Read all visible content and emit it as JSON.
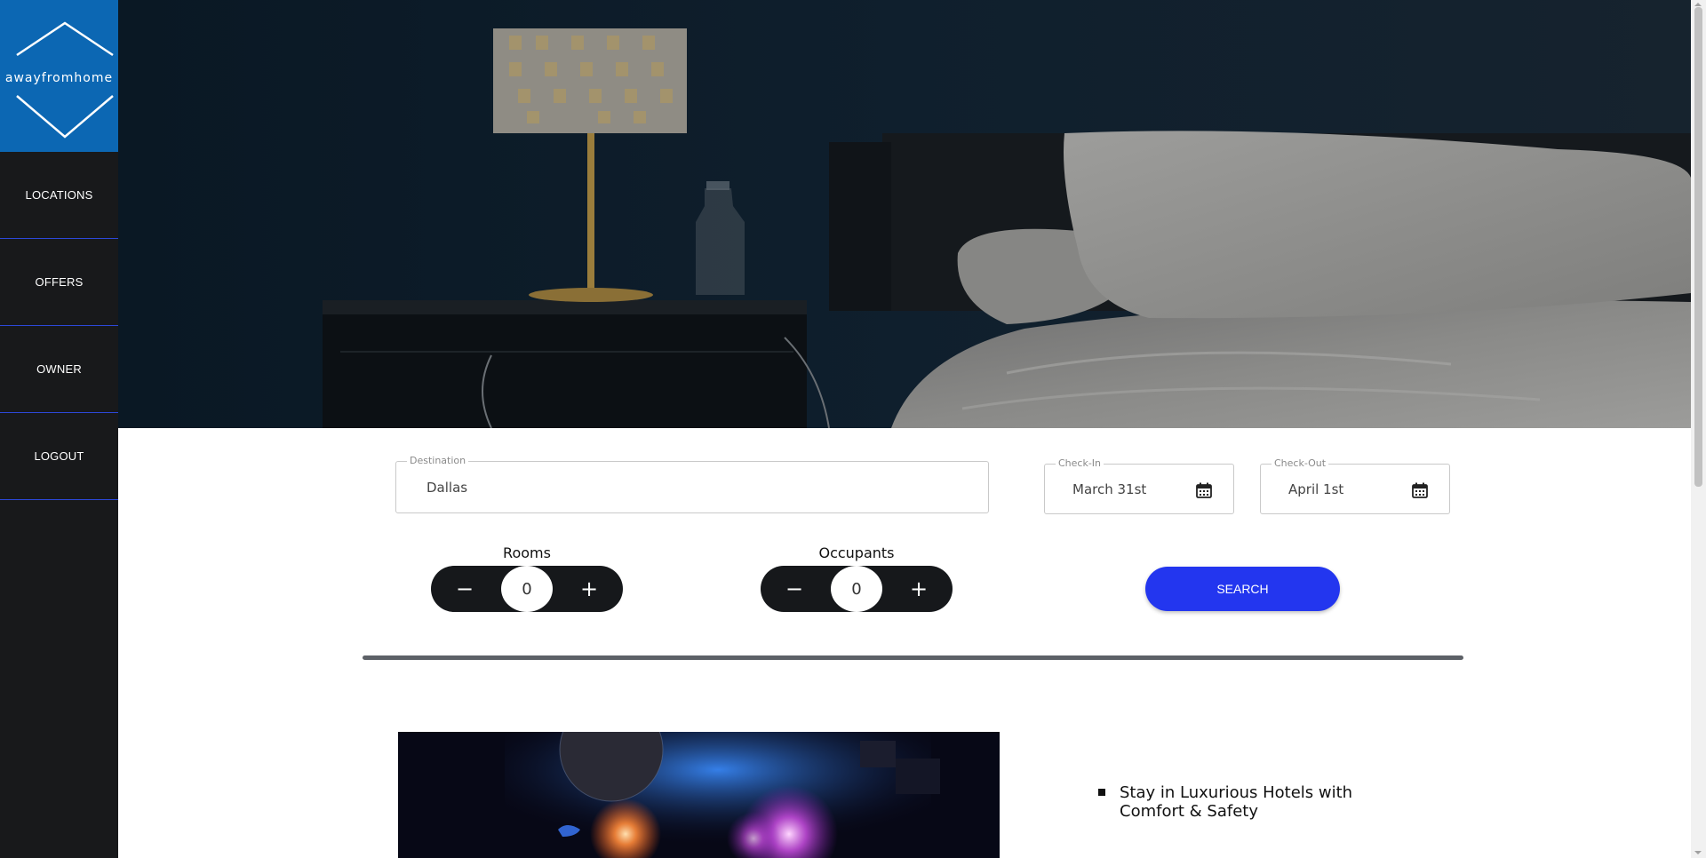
{
  "brand": {
    "name": "awayfromhome",
    "color": "#0c67b3"
  },
  "nav": {
    "items": [
      {
        "label": "LOCATIONS"
      },
      {
        "label": "OFFERS"
      },
      {
        "label": "OWNER"
      },
      {
        "label": "LOGOUT"
      }
    ]
  },
  "search": {
    "destination": {
      "legend": "Destination",
      "value": "Dallas"
    },
    "checkin": {
      "legend": "Check-In",
      "value": "March 31st",
      "icon": "calendar-icon"
    },
    "checkout": {
      "legend": "Check-Out",
      "value": "April 1st",
      "icon": "calendar-icon"
    },
    "rooms": {
      "label": "Rooms",
      "value": "0",
      "decrement": "−",
      "increment": "+"
    },
    "occupants": {
      "label": "Occupants",
      "value": "0",
      "decrement": "−",
      "increment": "+"
    },
    "button_label": "SEARCH",
    "accent_color": "#2336ef"
  },
  "features": [
    {
      "text": "Stay in Luxurious Hotels with Comfort & Safety"
    }
  ]
}
